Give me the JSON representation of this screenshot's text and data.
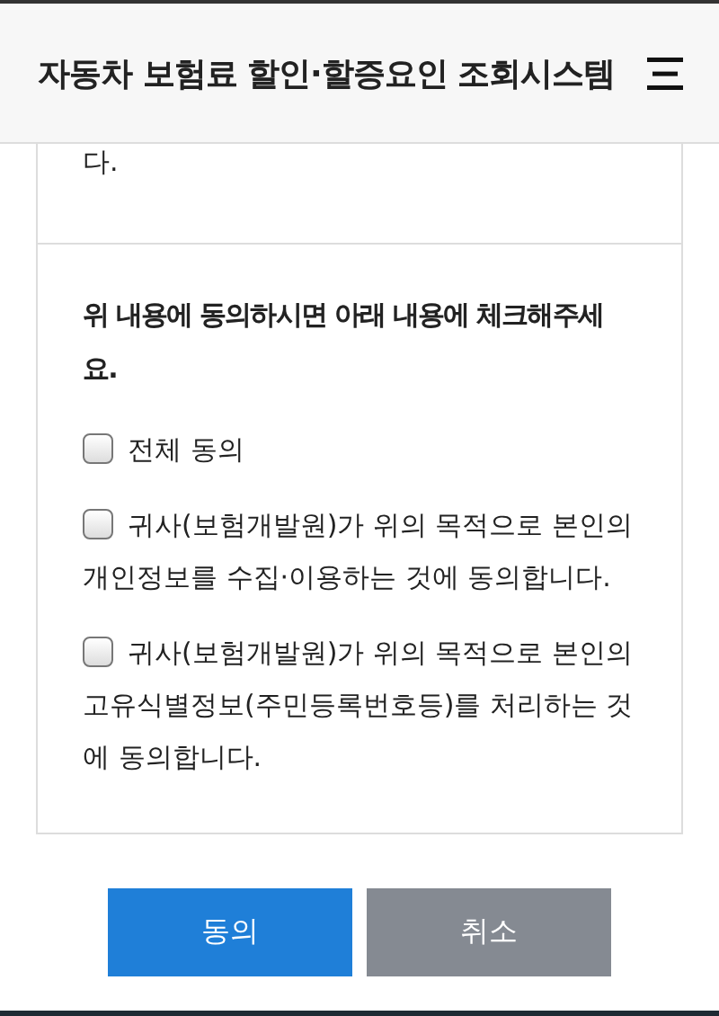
{
  "header": {
    "title": "자동차 보험료 할인·할증요인 조회시스템"
  },
  "previous_text": "다.",
  "consent": {
    "heading": "위 내용에 동의하시면 아래 내용에 체크해주세요.",
    "items": [
      {
        "label": "전체 동의",
        "checked": false
      },
      {
        "label": "귀사(보험개발원)가 위의 목적으로 본인의 개인정보를 수집·이용하는 것에 동의합니다.",
        "checked": false
      },
      {
        "label": "귀사(보험개발원)가 위의 목적으로 본인의 고유식별정보(주민등록번호등)를 처리하는 것에 동의합니다.",
        "checked": false
      }
    ]
  },
  "buttons": [
    {
      "label": "동의",
      "kind": "primary"
    },
    {
      "label": "취소",
      "kind": "secondary"
    }
  ]
}
